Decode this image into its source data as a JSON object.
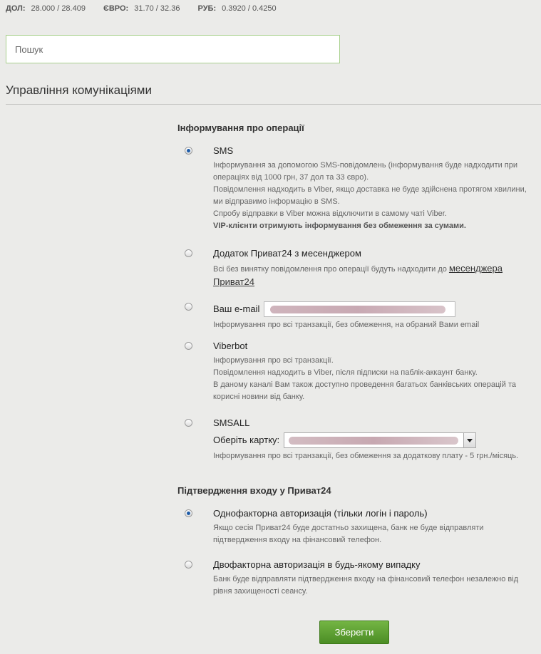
{
  "rates": [
    {
      "currency": "ДОЛ:",
      "value": "28.000 / 28.409"
    },
    {
      "currency": "ЄВРО:",
      "value": "31.70 / 32.36"
    },
    {
      "currency": "РУБ:",
      "value": "0.3920 / 0.4250"
    }
  ],
  "search": {
    "placeholder": "Пошук"
  },
  "page": {
    "title": "Управління комунікаціями"
  },
  "notifications": {
    "title": "Інформування про операції",
    "options": [
      {
        "label": "SMS",
        "checked": true,
        "desc": [
          "Інформування за допомогою SMS-повідомлень (інформування буде надходити при операціях від 1000 грн, 37 дол та 33 євро).",
          "Повідомлення надходить в Viber, якщо доставка не буде здійснена протягом хвилини, ми відправимо інформацію в SMS.",
          "Спробу відправки в Viber можна відключити в самому чаті Viber."
        ],
        "desc_strong": "VIP-клієнти отримують інформування без обмеження за сумами."
      },
      {
        "label": "Додаток Приват24 з месенджером",
        "checked": false,
        "desc_prefix": "Всі без винятку повідомлення про операції будуть надходити до ",
        "desc_link": "месенджера Приват24"
      },
      {
        "label": "Ваш e-mail",
        "checked": false,
        "desc": "Інформування про всі транзакції, без обмеження, на обраний Вами email"
      },
      {
        "label": "Viberbot",
        "checked": false,
        "desc": [
          "Інформування про всі транзакції.",
          "Повідомлення надходить в Viber, після підписки на паблік-аккаунт банку.",
          "В даному каналі Вам також доступно проведення багатьох банківських операцій та корисні новини від банку."
        ]
      },
      {
        "label": "SMSALL",
        "checked": false,
        "select_label": "Оберіть картку:",
        "desc": "Інформування про всі транзакції, без обмеження за додаткову плату - 5 грн./місяць."
      }
    ]
  },
  "login_confirmation": {
    "title": "Підтвердження входу у Приват24",
    "options": [
      {
        "label": "Однофакторна авторизація (тільки логін і пароль)",
        "checked": true,
        "desc": "Якщо сесія Приват24 буде достатньо захищена, банк не буде відправляти підтвердження входу на фінансовий телефон."
      },
      {
        "label": "Двофакторна авторизація в будь-якому випадку",
        "checked": false,
        "desc": "Банк буде відправляти підтвердження входу на фінансовий телефон незалежно від рівня захищеності сеансу."
      }
    ]
  },
  "save_button": {
    "label": "Зберегти"
  }
}
